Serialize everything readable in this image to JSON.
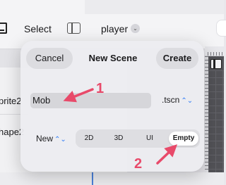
{
  "toolbar": {
    "select_label": "Select",
    "scene_name": "player"
  },
  "file_list": {
    "items": [
      "prite2",
      "hape2"
    ]
  },
  "dialog": {
    "cancel_label": "Cancel",
    "title": "New Scene",
    "create_label": "Create",
    "name_value": "Mob",
    "extension": ".tscn",
    "root_type": "New",
    "segments": [
      "2D",
      "3D",
      "UI",
      "Empty"
    ],
    "selected_segment": "Empty"
  },
  "annotations": {
    "step1": "1",
    "step2": "2",
    "color": "#e84a6a"
  },
  "colors": {
    "accent": "#2f7cf6",
    "annotation": "#e84a6a"
  }
}
